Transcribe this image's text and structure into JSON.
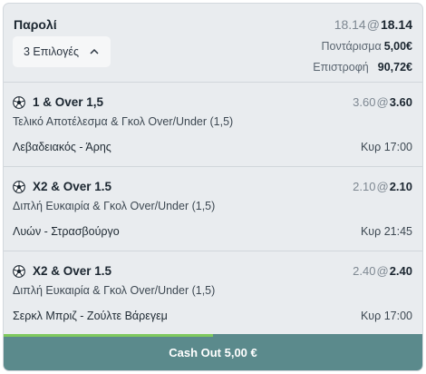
{
  "header": {
    "title": "Παρολί",
    "old_odds": "18.14",
    "at": "@",
    "new_odds": "18.14",
    "selections_button": "3 Επιλογές",
    "stake_label": "Ποντάρισμα",
    "stake_value": "5,00€",
    "return_label": "Επιστροφή",
    "return_value": "90,72€"
  },
  "selections": [
    {
      "icon": "soccer-ball-icon",
      "market": "1 & Over 1,5",
      "old_odds": "3.60",
      "new_odds": "3.60",
      "market_name": "Τελικό Αποτέλεσμα & Γκολ Over/Under (1,5)",
      "match": "Λεβαδειακός - Άρης",
      "time": "Κυρ 17:00"
    },
    {
      "icon": "soccer-ball-icon",
      "market": "X2 & Over 1.5",
      "old_odds": "2.10",
      "new_odds": "2.10",
      "market_name": "Διπλή Ευκαιρία & Γκολ Over/Under (1,5)",
      "match": "Λυών - Στρασβούργο",
      "time": "Κυρ 21:45"
    },
    {
      "icon": "soccer-ball-icon",
      "market": "X2 & Over 1.5",
      "old_odds": "2.40",
      "new_odds": "2.40",
      "market_name": "Διπλή Ευκαιρία & Γκολ Over/Under (1,5)",
      "match": "Σερκλ Μπριζ - Ζούλτε Βάρεγεμ",
      "time": "Κυρ 17:00"
    }
  ],
  "cashout": {
    "label": "Cash Out 5,00 €",
    "progress": 0.5,
    "bar_color": "#5b8a8c",
    "progress_color": "#7fc95e"
  }
}
